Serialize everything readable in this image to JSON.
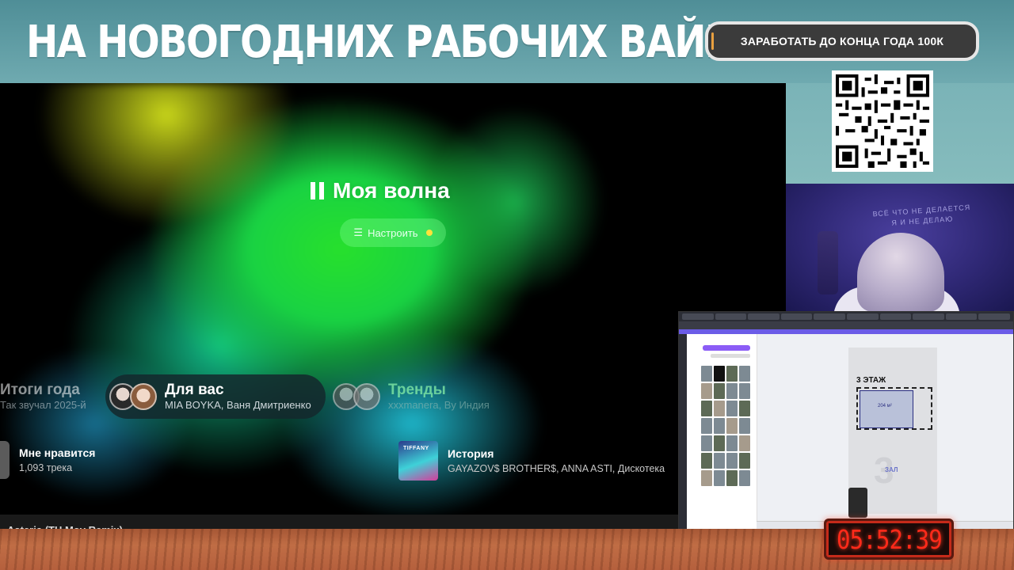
{
  "overlay": {
    "headline": "НА НОВОГОДНИХ РАБОЧИХ ВАЙБАХ",
    "cta_label": "ЗАРАБОТАТЬ ДО КОНЦА ГОДА 100К",
    "timer": "05:52:39"
  },
  "webcam": {
    "wall_text_line1": "ВСЁ ЧТО НЕ ДЕЛАЕТСЯ",
    "wall_text_line2": "Я И НЕ ДЕЛАЮ"
  },
  "music": {
    "wave_title": "Моя волна",
    "tune_label": "Настроить",
    "chips": [
      {
        "title": "Итоги года",
        "subtitle": "Так звучал 2025-й"
      },
      {
        "title": "Для вас",
        "subtitle": "MIA BOYKA, Ваня Дмитриенко"
      },
      {
        "title": "Тренды",
        "subtitle": "xxxmanera, Ву Индия"
      }
    ],
    "rows": [
      {
        "title": "Мне нравится",
        "subtitle": "1,093 трека"
      },
      {
        "title": "История",
        "subtitle": "GAYAZOV$ BROTHER$, ANNA ASTI, Дискотека"
      }
    ],
    "now_playing": "Asteria (TH Mov Remix)"
  },
  "screen2": {
    "floor_title": "3 ЭТАЖ",
    "room_label": "204 м²",
    "big_number": "3",
    "hall_label": "ЗАЛ"
  },
  "colors": {
    "accent_green": "#27e02c",
    "timer_red": "#ff2a1a",
    "cta_bg": "#3b3b3b"
  }
}
